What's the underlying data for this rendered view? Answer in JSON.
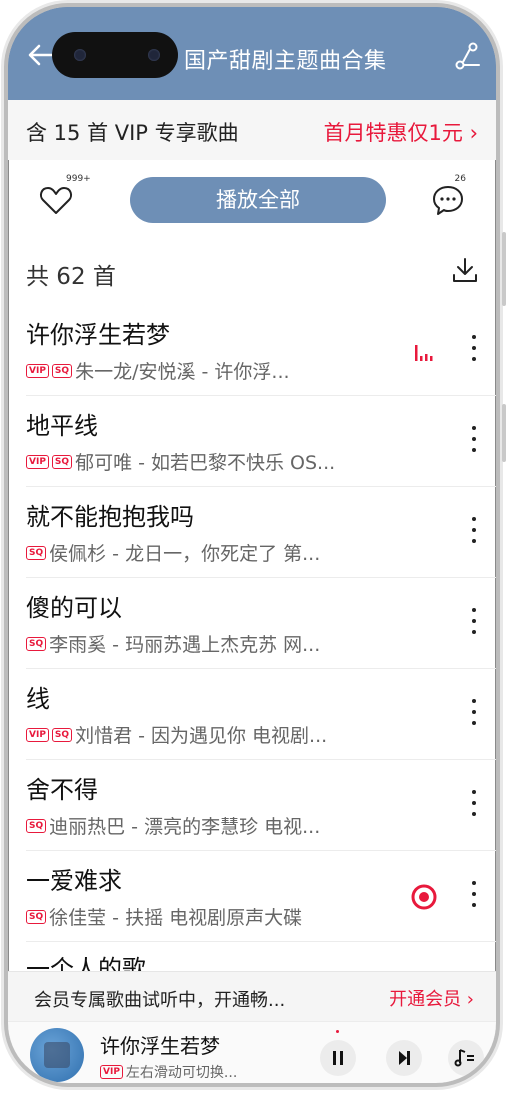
{
  "header": {
    "title": "国产甜剧主题曲合集"
  },
  "vip_banner": {
    "left_text": "含 15 首 VIP 专享歌曲",
    "right_text": "首月特惠仅1元 ›"
  },
  "actions": {
    "like_count": "999+",
    "play_all_label": "播放全部",
    "comment_count": "26"
  },
  "count_label": "共 62 首",
  "songs": [
    {
      "title": "许你浮生若梦",
      "tags": [
        "VIP",
        "SQ"
      ],
      "subtitle": "朱一龙/安悦溪 - 许你浮...",
      "state": "playing"
    },
    {
      "title": "地平线",
      "tags": [
        "VIP",
        "SQ"
      ],
      "subtitle": "郁可唯 - 如若巴黎不快乐 OS...",
      "state": ""
    },
    {
      "title": "就不能抱抱我吗",
      "tags": [
        "SQ"
      ],
      "subtitle": "侯佩杉 - 龙日一，你死定了 第...",
      "state": ""
    },
    {
      "title": "傻的可以",
      "tags": [
        "SQ"
      ],
      "subtitle": "李雨奚 - 玛丽苏遇上杰克苏 网...",
      "state": ""
    },
    {
      "title": "线",
      "tags": [
        "VIP",
        "SQ"
      ],
      "subtitle": "刘惜君 - 因为遇见你 电视剧...",
      "state": ""
    },
    {
      "title": "舍不得",
      "tags": [
        "SQ"
      ],
      "subtitle": "迪丽热巴 - 漂亮的李慧珍 电视...",
      "state": ""
    },
    {
      "title": "一爱难求",
      "tags": [
        "SQ"
      ],
      "subtitle": "徐佳莹 - 扶摇 电视剧原声大碟",
      "state": "recording"
    }
  ],
  "partial_song_title": "一个人的歌",
  "trial_bar": {
    "text": "会员专属歌曲试听中，开通畅...",
    "action": "开通会员 ›"
  },
  "player": {
    "title": "许你浮生若梦",
    "tag": "VIP",
    "subtitle": "左右滑动可切换..."
  },
  "colors": {
    "header_bg": "#6e8fb6",
    "accent_red": "#e8193c"
  }
}
